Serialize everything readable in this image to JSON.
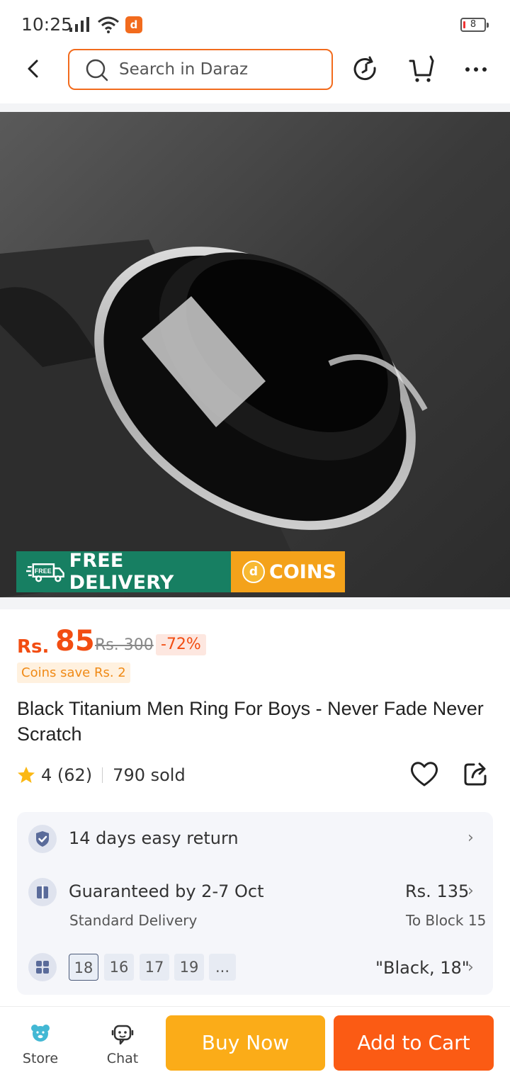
{
  "status_bar": {
    "time": "10:25",
    "battery": "8"
  },
  "header": {
    "search_placeholder": "Search in Daraz"
  },
  "hero": {
    "free_delivery_label": "FREE DELIVERY",
    "free_tag": "FREE",
    "coins_label": "COINS"
  },
  "price": {
    "currency": "Rs.",
    "amount": "85",
    "original": "Rs. 300",
    "discount": "-72%",
    "coins_save": "Coins save Rs. 2"
  },
  "product": {
    "title": "Black Titanium Men Ring For Boys - Never Fade Never Scratch",
    "rating": "4 (62)",
    "sold": "790 sold"
  },
  "info": {
    "return_label": "14 days easy return",
    "delivery_label": "Guaranteed by 2-7 Oct",
    "delivery_sub": "Standard Delivery",
    "delivery_price": "Rs. 135",
    "delivery_to": "To Block 15",
    "variants": [
      "18",
      "16",
      "17",
      "19",
      "..."
    ],
    "selected_variant": "\"Black, 18\""
  },
  "bottom_bar": {
    "store_label": "Store",
    "chat_label": "Chat",
    "buy_now_label": "Buy Now",
    "add_to_cart_label": "Add to Cart"
  },
  "colors": {
    "accent": "#f26b1d",
    "price": "#f24d12",
    "free_delivery_bg": "#177f62",
    "coins_bg": "#f4a21a",
    "buy_now_bg": "#fbac18",
    "add_to_cart_bg": "#fb5b14"
  },
  "icons": [
    "back-arrow-icon",
    "search-icon",
    "history-icon",
    "cart-icon",
    "more-icon",
    "star-icon",
    "heart-icon",
    "share-icon",
    "shield-check-icon",
    "delivery-box-icon",
    "variants-grid-icon",
    "chevron-right-icon",
    "store-icon",
    "chat-icon"
  ]
}
